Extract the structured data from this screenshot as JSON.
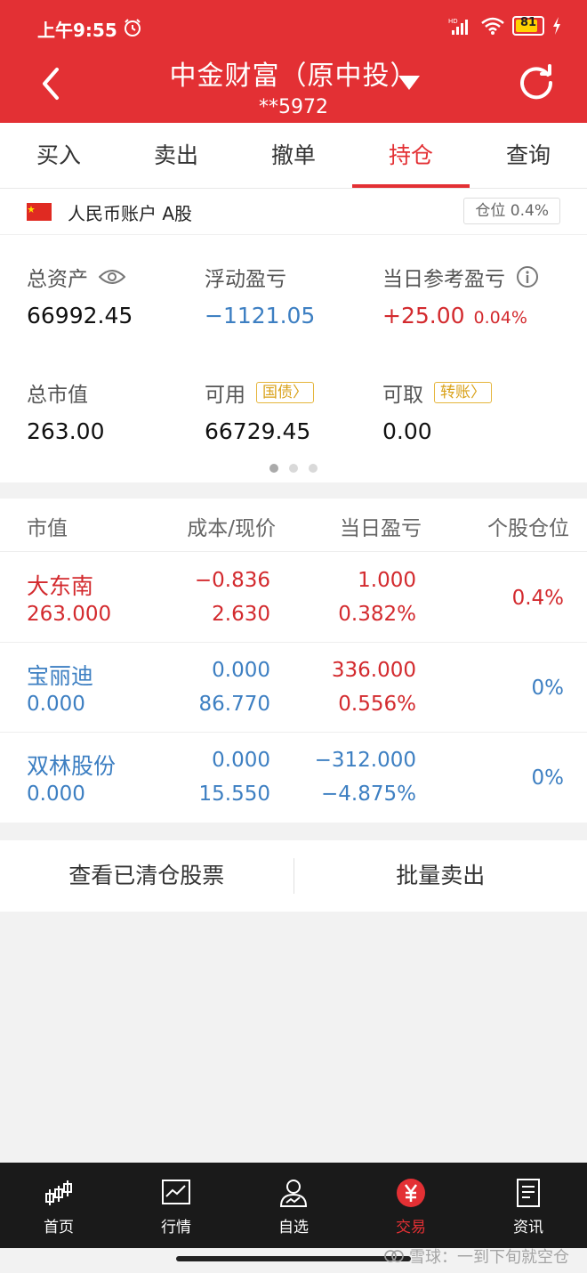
{
  "status_bar": {
    "time": "上午9:55",
    "battery": "81"
  },
  "header": {
    "title": "中金财富（原中投）",
    "account": "**5972"
  },
  "tabs": [
    "买入",
    "卖出",
    "撤单",
    "持仓",
    "查询"
  ],
  "account_panel": {
    "label": "人民币账户 A股",
    "position_badge": "仓位 0.4%",
    "total_assets_label": "总资产",
    "total_assets": "66992.45",
    "floating_pl_label": "浮动盈亏",
    "floating_pl": "−1121.05",
    "daily_pl_label": "当日参考盈亏",
    "daily_pl": "+25.00",
    "daily_pl_pct": "0.04%",
    "market_value_label": "总市值",
    "market_value": "263.00",
    "available_label": "可用",
    "available_tag": "国债",
    "available": "66729.45",
    "withdrawable_label": "可取",
    "withdrawable_tag": "转账",
    "withdrawable": "0.00"
  },
  "holdings": {
    "headers": [
      "市值",
      "成本/现价",
      "当日盈亏",
      "个股仓位"
    ],
    "rows": [
      {
        "name": "大东南",
        "market_value": "263.000",
        "cost": "−0.836",
        "price": "2.630",
        "daily_pl": "1.000",
        "daily_pct": "0.382%",
        "position": "0.4%"
      },
      {
        "name": "宝丽迪",
        "market_value": "0.000",
        "cost": "0.000",
        "price": "86.770",
        "daily_pl": "336.000",
        "daily_pct": "0.556%",
        "position": "0%"
      },
      {
        "name": "双林股份",
        "market_value": "0.000",
        "cost": "0.000",
        "price": "15.550",
        "daily_pl": "−312.000",
        "daily_pct": "−4.875%",
        "position": "0%"
      }
    ]
  },
  "actions": {
    "cleared": "查看已清仓股票",
    "batch_sell": "批量卖出"
  },
  "bottom_nav": [
    "首页",
    "行情",
    "自选",
    "交易",
    "资讯"
  ],
  "watermark": "雪球：一到下旬就空仓",
  "colors": {
    "brand": "#e33034",
    "up": "#d32a2e",
    "down": "#3d7fc2",
    "tag": "#d9a21b"
  }
}
